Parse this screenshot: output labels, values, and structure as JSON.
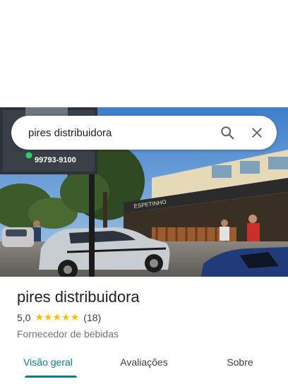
{
  "search": {
    "query": "pires distribuidora"
  },
  "photo": {
    "sign_phone": "99793-9100",
    "storefront_sign": "ESPETINHO"
  },
  "place": {
    "name": "pires distribuidora",
    "rating": "5,0",
    "stars": [
      "★",
      "★",
      "★",
      "★",
      "★"
    ],
    "review_count": "(18)",
    "category": "Fornecedor de bebidas"
  },
  "tabs": [
    {
      "label": "Visão geral",
      "active": true
    },
    {
      "label": "Avaliações",
      "active": false
    },
    {
      "label": "Sobre",
      "active": false
    }
  ],
  "colors": {
    "accent": "#0b7e8a",
    "star": "#fbbc04"
  },
  "icons": {
    "search": "search-icon",
    "close": "close-icon"
  }
}
